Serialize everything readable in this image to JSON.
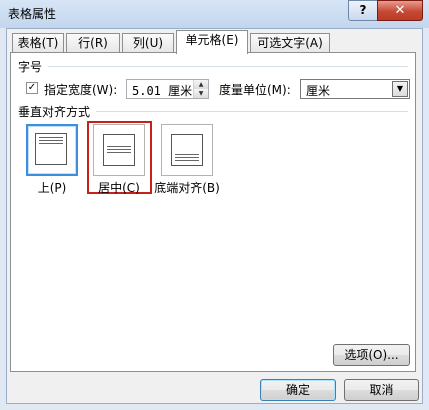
{
  "window": {
    "title": "表格属性",
    "help_glyph": "?",
    "close_glyph": "✕"
  },
  "tabs": [
    {
      "label": "表格(T)",
      "active": false
    },
    {
      "label": "行(R)",
      "active": false
    },
    {
      "label": "列(U)",
      "active": false
    },
    {
      "label": "单元格(E)",
      "active": true
    },
    {
      "label": "可选文字(A)",
      "active": false
    }
  ],
  "size_group": {
    "header": "字号",
    "width_check_label": "指定宽度(W):",
    "width_checked": true,
    "check_glyph": "✓",
    "width_value": "5.01 厘米",
    "unit_label": "度量单位(M):",
    "unit_value": "厘米"
  },
  "valign_group": {
    "header": "垂直对齐方式",
    "options": [
      {
        "label": "上(P)",
        "selected": true
      },
      {
        "label": "居中(C)",
        "selected": false,
        "highlighted": true
      },
      {
        "label": "底端对齐(B)",
        "selected": false
      }
    ]
  },
  "buttons": {
    "options": "选项(O)...",
    "ok": "确定",
    "cancel": "取消"
  },
  "colors": {
    "highlight_red": "#c8201c",
    "selected_blue": "#3d8fdb"
  }
}
